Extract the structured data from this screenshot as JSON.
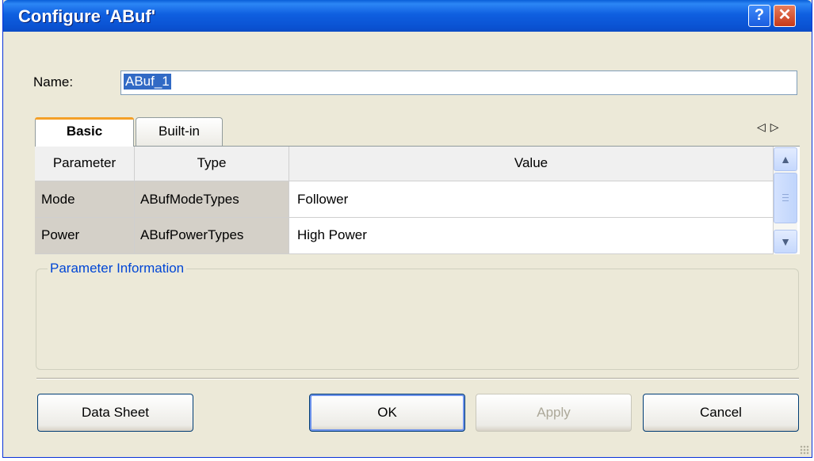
{
  "window": {
    "title": "Configure 'ABuf'",
    "help_glyph": "?",
    "close_glyph": "✕"
  },
  "name": {
    "label": "Name:",
    "value": "ABuf_1"
  },
  "tabs": [
    {
      "label": "Basic",
      "active": true
    },
    {
      "label": "Built-in",
      "active": false
    }
  ],
  "tab_scroll": {
    "left_icon": "◁",
    "right_icon": "▷"
  },
  "grid": {
    "headers": [
      "Parameter",
      "Type",
      "Value"
    ],
    "rows": [
      {
        "parameter": "Mode",
        "type": "ABufModeTypes",
        "value": "Follower"
      },
      {
        "parameter": "Power",
        "type": "ABufPowerTypes",
        "value": "High Power"
      }
    ],
    "scroll_up_icon": "▲",
    "scroll_down_icon": "▼"
  },
  "info": {
    "legend": "Parameter Information"
  },
  "buttons": {
    "datasheet": "Data Sheet",
    "ok": "OK",
    "apply": "Apply",
    "cancel": "Cancel"
  },
  "colors": {
    "titlebar": "#0a52d2",
    "window_bg": "#ece9d8",
    "legend": "#0046d5",
    "selection": "#316ac5"
  }
}
